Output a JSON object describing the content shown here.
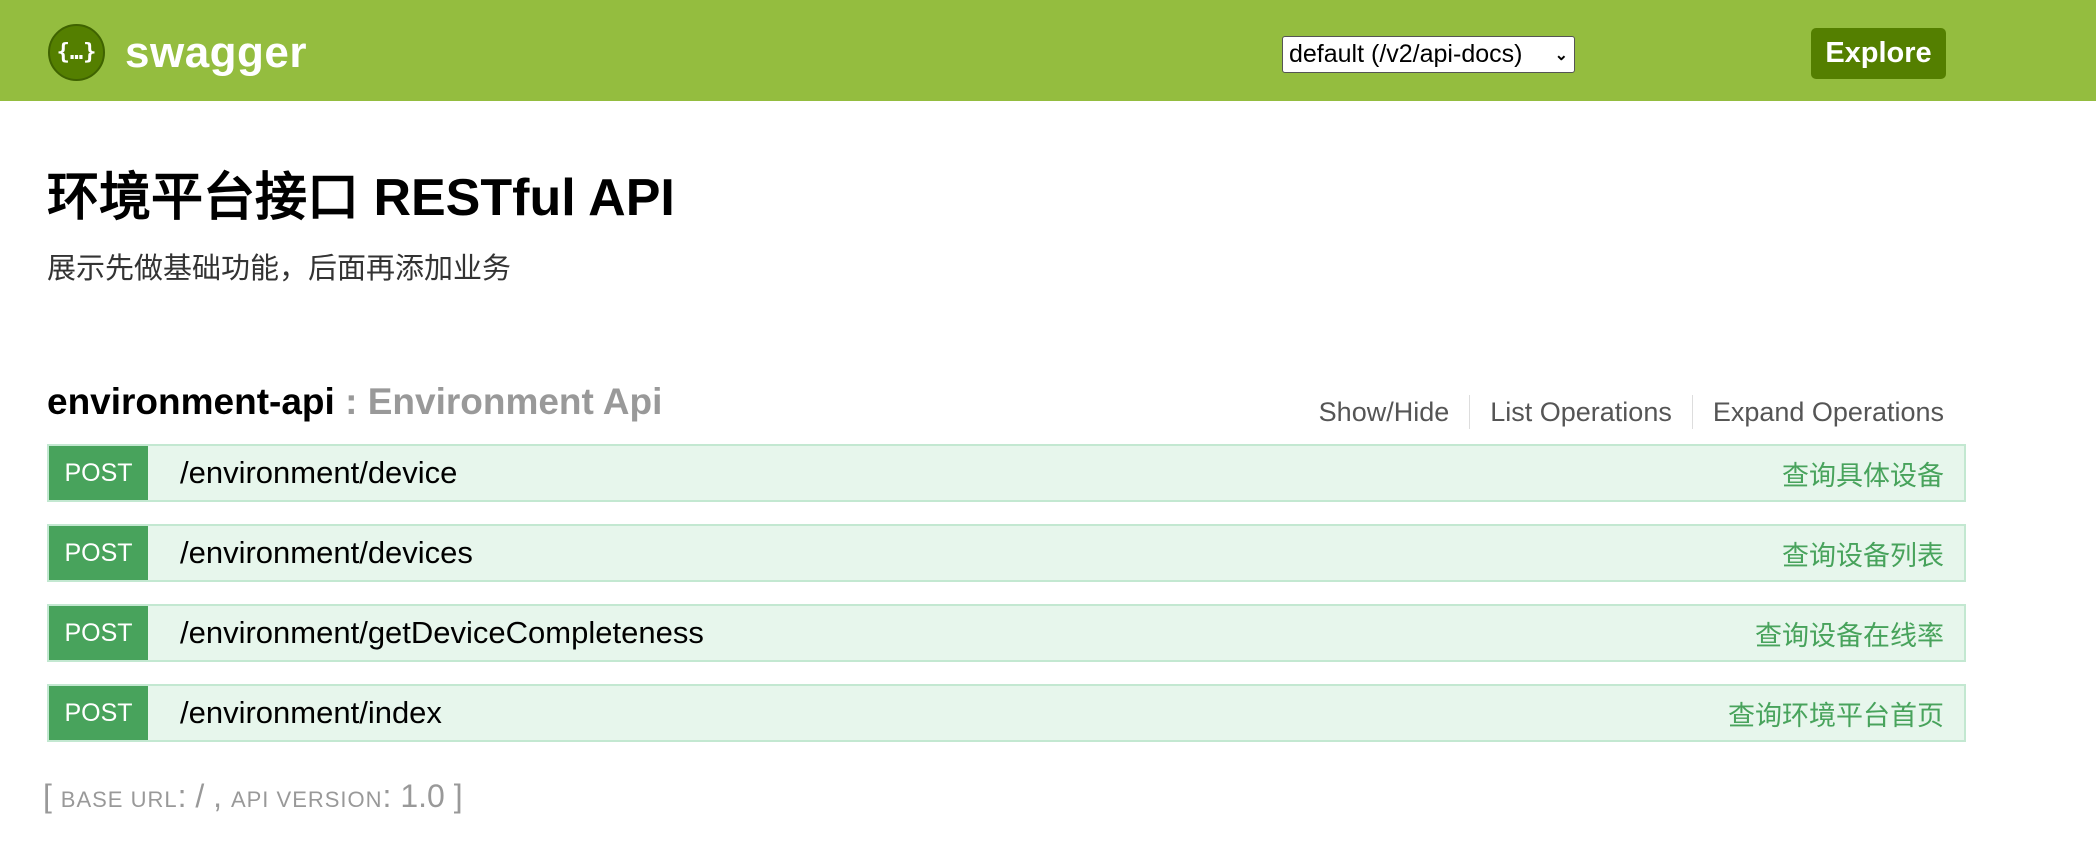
{
  "header": {
    "logo_glyph": "{…}",
    "logo_text": "swagger",
    "spec_select": "default (/v2/api-docs)",
    "explore_label": "Explore"
  },
  "info": {
    "title": "环境平台接口 RESTful API",
    "description": "展示先做基础功能，后面再添加业务"
  },
  "group": {
    "name": "environment-api",
    "separator": " : ",
    "description": "Environment Api",
    "links": [
      "Show/Hide",
      "List Operations",
      "Expand Operations"
    ]
  },
  "operations": [
    {
      "method": "POST",
      "path": "/environment/device",
      "summary": "查询具体设备"
    },
    {
      "method": "POST",
      "path": "/environment/devices",
      "summary": "查询设备列表"
    },
    {
      "method": "POST",
      "path": "/environment/getDeviceCompleteness",
      "summary": "查询设备在线率"
    },
    {
      "method": "POST",
      "path": "/environment/index",
      "summary": "查询环境平台首页"
    }
  ],
  "footer": {
    "open_bracket": "[",
    "base_url_label": "BASE URL",
    "colon1": ": ",
    "base_url_value": "/",
    "comma": " , ",
    "api_version_label": "API VERSION",
    "colon2": ": ",
    "api_version_value": "1.0",
    "close_bracket": "]"
  },
  "colors": {
    "header_bg": "#94bd3f",
    "explore_bg": "#547f00",
    "post_method": "#48a35c",
    "post_row_bg": "#e7f6ec"
  },
  "icons": {
    "logo": "swagger-logo-icon",
    "select": "chevron-down-icon"
  }
}
